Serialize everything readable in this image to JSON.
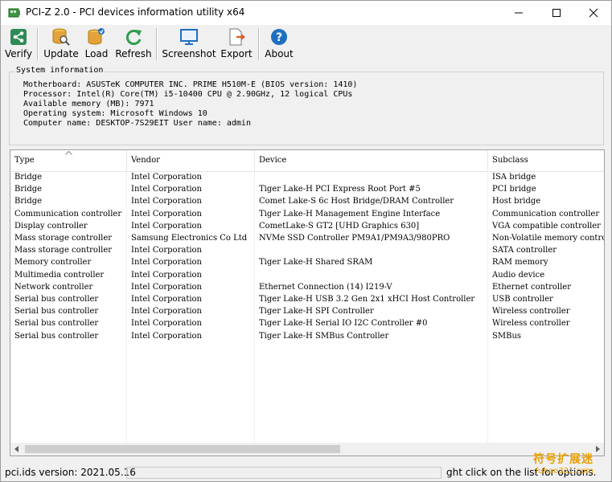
{
  "window": {
    "title": "PCI-Z 2.0  -  PCI devices information utility x64"
  },
  "toolbar": {
    "verify": "Verify",
    "update": "Update",
    "load": "Load",
    "refresh": "Refresh",
    "screenshot": "Screenshot",
    "export": "Export",
    "about": "About"
  },
  "sysinfo": {
    "legend": "System information",
    "lines": [
      "Motherboard: ASUSTeK COMPUTER INC. PRIME H510M-E (BIOS version: 1410)",
      "Processor: Intel(R) Core(TM) i5-10400 CPU @ 2.90GHz, 12 logical CPUs",
      "Available memory (MB): 7971",
      "Operating system: Microsoft Windows 10",
      "Computer name: DESKTOP-7S29EIT  User name: admin"
    ]
  },
  "table": {
    "columns": [
      "Type",
      "Vendor",
      "Device",
      "Subclass"
    ],
    "rows": [
      [
        "Bridge",
        "Intel Corporation",
        "",
        "ISA bridge"
      ],
      [
        "Bridge",
        "Intel Corporation",
        "Tiger Lake-H PCI Express Root Port #5",
        "PCI bridge"
      ],
      [
        "Bridge",
        "Intel Corporation",
        "Comet Lake-S 6c Host Bridge/DRAM Controller",
        "Host bridge"
      ],
      [
        "Communication controller",
        "Intel Corporation",
        "Tiger Lake-H Management Engine Interface",
        "Communication controller"
      ],
      [
        "Display controller",
        "Intel Corporation",
        "CometLake-S GT2 [UHD Graphics 630]",
        "VGA compatible controller"
      ],
      [
        "Mass storage controller",
        "Samsung Electronics Co Ltd",
        "NVMe SSD Controller PM9A1/PM9A3/980PRO",
        "Non-Volatile memory controller"
      ],
      [
        "Mass storage controller",
        "Intel Corporation",
        "",
        "SATA controller"
      ],
      [
        "Memory controller",
        "Intel Corporation",
        "Tiger Lake-H Shared SRAM",
        "RAM memory"
      ],
      [
        "Multimedia controller",
        "Intel Corporation",
        "",
        "Audio device"
      ],
      [
        "Network controller",
        "Intel Corporation",
        "Ethernet Connection (14) I219-V",
        "Ethernet controller"
      ],
      [
        "Serial bus controller",
        "Intel Corporation",
        "Tiger Lake-H USB 3.2 Gen 2x1 xHCI Host Controller",
        "USB controller"
      ],
      [
        "Serial bus controller",
        "Intel Corporation",
        "Tiger Lake-H SPI Controller",
        "Wireless controller"
      ],
      [
        "Serial bus controller",
        "Intel Corporation",
        "Tiger Lake-H Serial IO I2C Controller #0",
        "Wireless controller"
      ],
      [
        "Serial bus controller",
        "Intel Corporation",
        "Tiger Lake-H SMBus Controller",
        "SMBus"
      ]
    ]
  },
  "status": {
    "version": "pci.ids version: 2021.05.16",
    "hint": "ght click on the list for options."
  },
  "watermark": {
    "line1": "符号扩展迷",
    "line2": "fuhao321.com"
  },
  "icons": {
    "verify": "share-icon",
    "update": "search-db-icon",
    "load": "load-db-icon",
    "refresh": "refresh-icon",
    "screenshot": "monitor-icon",
    "export": "export-icon",
    "about": "help-icon"
  },
  "colors": {
    "verify": "#2e8b57",
    "accent_blue": "#1e6fc0",
    "db_orange": "#e3a33a"
  }
}
